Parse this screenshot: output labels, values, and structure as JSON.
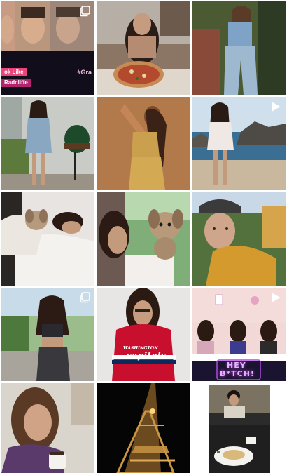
{
  "grid": {
    "tiles": [
      {
        "name": "post-thumbnail",
        "badge": "carousel-icon",
        "overlay": {
          "tag1": "ok Like",
          "tag2": "Radcliffe",
          "hashtag": "#Gra"
        }
      },
      {
        "name": "post-thumbnail",
        "badge": null
      },
      {
        "name": "post-thumbnail",
        "badge": null
      },
      {
        "name": "post-thumbnail",
        "badge": null
      },
      {
        "name": "post-thumbnail",
        "badge": null
      },
      {
        "name": "post-thumbnail",
        "badge": "video-play-icon"
      },
      {
        "name": "post-thumbnail",
        "badge": null
      },
      {
        "name": "post-thumbnail",
        "badge": null
      },
      {
        "name": "post-thumbnail",
        "badge": null
      },
      {
        "name": "post-thumbnail",
        "badge": "carousel-icon"
      },
      {
        "name": "post-thumbnail",
        "badge": null,
        "overlay": {
          "jersey_small": "WASHINGTON",
          "jersey_big": "capitals"
        }
      },
      {
        "name": "post-thumbnail",
        "badge": "video-play-icon",
        "overlay": {
          "neon1": "HEY",
          "neon2": "B*TCH!"
        }
      },
      {
        "name": "post-thumbnail",
        "badge": null
      },
      {
        "name": "post-thumbnail",
        "badge": null
      },
      {
        "name": "post-thumbnail",
        "badge": null
      }
    ]
  },
  "colors": {
    "background": "#ffffff",
    "badge": "#ffffff",
    "tag_pink": "#e8467a",
    "tag_magenta": "#b3246f"
  }
}
